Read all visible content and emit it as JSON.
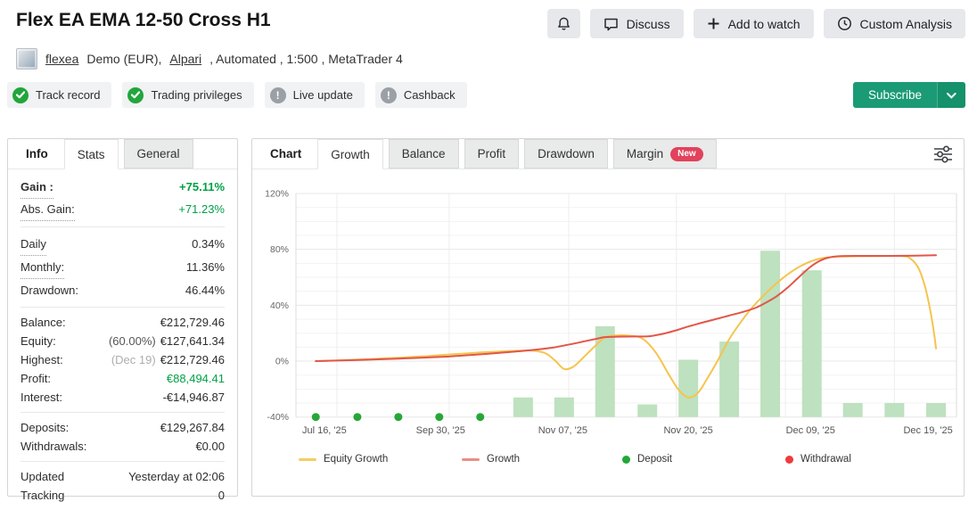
{
  "header": {
    "title": "Flex EA EMA 12-50 Cross H1",
    "actions": [
      {
        "icon": "bell",
        "label": ""
      },
      {
        "icon": "chat-bubble",
        "label": "Discuss"
      },
      {
        "icon": "plus",
        "label": "Add to watch"
      },
      {
        "icon": "clock",
        "label": "Custom Analysis"
      }
    ],
    "account": {
      "name": "flexea",
      "info_1": "Demo (EUR),",
      "broker": "Alpari",
      "info_2": ", Automated , 1:500 , MetaTrader 4"
    },
    "badges": [
      {
        "label": "Track record",
        "status": "verified",
        "icon": "check"
      },
      {
        "label": "Trading privileges",
        "status": "verified",
        "icon": "check"
      },
      {
        "label": "Live update",
        "status": "info",
        "icon": "exclamation"
      },
      {
        "label": "Cashback",
        "status": "info",
        "icon": "exclamation"
      }
    ],
    "subscribe_label": "Subscribe",
    "subscribe_color": "#1a9b75"
  },
  "sidebar": {
    "tabs": [
      {
        "label": "Info",
        "state": "title"
      },
      {
        "label": "Stats",
        "state": "selected"
      },
      {
        "label": "General",
        "state": "normal"
      }
    ],
    "groups": [
      {
        "sp": "sp1",
        "rows": [
          {
            "label": "Gain :",
            "dotted": true,
            "lbold": true,
            "value": "+75.11%",
            "vclass": "green bold"
          },
          {
            "label": "Abs. Gain:",
            "dotted": true,
            "value": "+71.23%",
            "vclass": "green"
          }
        ]
      },
      {
        "sp": "sp2",
        "rows": [
          {
            "label": "Daily",
            "dotted": true,
            "value": "0.34%"
          },
          {
            "label": "Monthly:",
            "dotted": true,
            "value": "11.36%"
          },
          {
            "label": "Drawdown:",
            "value": "46.44%"
          }
        ]
      },
      {
        "rows": [
          {
            "label": "Balance:",
            "value": "€212,729.46"
          },
          {
            "label": "Equity:",
            "prefix": "(60.00%)",
            "value": "€127,641.34"
          },
          {
            "label": "Highest:",
            "prefix": "(Dec 19)",
            "prefix_light": true,
            "value": "€212,729.46"
          },
          {
            "label": "Profit:",
            "value": "€88,494.41",
            "vclass": "green"
          },
          {
            "label": "Interest:",
            "value": "-€14,946.87"
          }
        ]
      },
      {
        "rows": [
          {
            "label": "Deposits:",
            "value": "€129,267.84"
          },
          {
            "label": "Withdrawals:",
            "value": "€0.00"
          }
        ]
      },
      {
        "rows": [
          {
            "label": "Updated",
            "value": "Yesterday at 02:06"
          },
          {
            "label": "Tracking",
            "value": "0"
          }
        ]
      }
    ]
  },
  "chart_panel": {
    "tabs": [
      {
        "label": "Chart",
        "state": "title"
      },
      {
        "label": "Growth",
        "state": "selected"
      },
      {
        "label": "Balance",
        "state": "normal"
      },
      {
        "label": "Profit",
        "state": "normal"
      },
      {
        "label": "Drawdown",
        "state": "normal"
      },
      {
        "label": "Margin",
        "state": "normal",
        "badge": "New"
      }
    ],
    "filter_icon": "sliders"
  },
  "chart_data": {
    "type": "mixed",
    "title": "Growth",
    "ylim": [
      -40,
      120
    ],
    "y_major_step": 40,
    "y_minor_step": 10,
    "y_tick_labels": [
      "-40%",
      "0%",
      "40%",
      "80%",
      "120%"
    ],
    "grid": true,
    "x_labels": [
      {
        "label": "Jul 16, '25",
        "pos": 0.043
      },
      {
        "label": "Sep 30, '25",
        "pos": 0.219
      },
      {
        "label": "Nov 07, '25",
        "pos": 0.404
      },
      {
        "label": "Nov 20, '25",
        "pos": 0.594
      },
      {
        "label": "Dec 09, '25",
        "pos": 0.779
      },
      {
        "label": "Dec 19, '25",
        "pos": 0.957
      }
    ],
    "vgrid_pos": [
      0.062,
      0.232,
      0.413,
      0.576,
      0.741,
      0.906
    ],
    "series": [
      {
        "name": "bars",
        "type": "bar",
        "color": "#bee1bf",
        "points": [
          [
            0.344,
            -26
          ],
          [
            0.406,
            -26
          ],
          [
            0.468,
            25
          ],
          [
            0.532,
            -31
          ],
          [
            0.594,
            1
          ],
          [
            0.656,
            14
          ],
          [
            0.718,
            79
          ],
          [
            0.781,
            65
          ],
          [
            0.843,
            -30
          ],
          [
            0.906,
            -30
          ],
          [
            0.969,
            -30
          ]
        ]
      },
      {
        "name": "Equity Growth",
        "type": "line",
        "color": "#f5c44e",
        "points": [
          [
            0.03,
            0
          ],
          [
            0.065,
            0.5
          ],
          [
            0.1,
            1.2
          ],
          [
            0.135,
            2.0
          ],
          [
            0.17,
            2.8
          ],
          [
            0.2,
            3.6
          ],
          [
            0.219,
            4.3
          ],
          [
            0.25,
            5.3
          ],
          [
            0.28,
            6.2
          ],
          [
            0.31,
            6.9
          ],
          [
            0.335,
            7.4
          ],
          [
            0.36,
            7.4
          ],
          [
            0.378,
            5.5
          ],
          [
            0.392,
            0.5
          ],
          [
            0.406,
            -5.6
          ],
          [
            0.42,
            -4.0
          ],
          [
            0.435,
            2.5
          ],
          [
            0.45,
            9.5
          ],
          [
            0.468,
            17.0
          ],
          [
            0.485,
            18.4
          ],
          [
            0.505,
            18.2
          ],
          [
            0.525,
            16.0
          ],
          [
            0.545,
            6.0
          ],
          [
            0.565,
            -10.0
          ],
          [
            0.58,
            -21.0
          ],
          [
            0.594,
            -26.0
          ],
          [
            0.608,
            -23.0
          ],
          [
            0.622,
            -13.0
          ],
          [
            0.638,
            0.0
          ],
          [
            0.655,
            15.0
          ],
          [
            0.672,
            27.0
          ],
          [
            0.69,
            38.0
          ],
          [
            0.708,
            47.0
          ],
          [
            0.726,
            55.0
          ],
          [
            0.744,
            62.0
          ],
          [
            0.762,
            67.5
          ],
          [
            0.78,
            71.5
          ],
          [
            0.798,
            73.8
          ],
          [
            0.82,
            74.8
          ],
          [
            0.85,
            75.1
          ],
          [
            0.88,
            75.2
          ],
          [
            0.918,
            75.2
          ],
          [
            0.93,
            73.5
          ],
          [
            0.942,
            67.0
          ],
          [
            0.952,
            54.0
          ],
          [
            0.96,
            37.0
          ],
          [
            0.966,
            20.0
          ],
          [
            0.969,
            9.0
          ]
        ]
      },
      {
        "name": "Growth",
        "type": "line",
        "color": "#e25649",
        "points": [
          [
            0.03,
            0
          ],
          [
            0.1,
            0.9
          ],
          [
            0.155,
            1.8
          ],
          [
            0.219,
            3.0
          ],
          [
            0.26,
            4.2
          ],
          [
            0.3,
            5.6
          ],
          [
            0.335,
            7.0
          ],
          [
            0.365,
            8.3
          ],
          [
            0.39,
            9.8
          ],
          [
            0.415,
            12.0
          ],
          [
            0.44,
            14.5
          ],
          [
            0.458,
            16.3
          ],
          [
            0.468,
            17.2
          ],
          [
            0.49,
            17.5
          ],
          [
            0.515,
            17.6
          ],
          [
            0.535,
            17.8
          ],
          [
            0.555,
            19.5
          ],
          [
            0.575,
            22.0
          ],
          [
            0.594,
            24.8
          ],
          [
            0.615,
            27.5
          ],
          [
            0.635,
            30.0
          ],
          [
            0.655,
            32.5
          ],
          [
            0.675,
            35.0
          ],
          [
            0.695,
            38.0
          ],
          [
            0.712,
            42.0
          ],
          [
            0.728,
            46.5
          ],
          [
            0.744,
            52.5
          ],
          [
            0.76,
            59.5
          ],
          [
            0.775,
            66.0
          ],
          [
            0.79,
            71.0
          ],
          [
            0.805,
            74.0
          ],
          [
            0.825,
            75.2
          ],
          [
            0.87,
            75.3
          ],
          [
            0.92,
            75.4
          ],
          [
            0.969,
            75.8
          ]
        ]
      },
      {
        "name": "Deposit",
        "type": "scatter",
        "color": "#27a737",
        "points": [
          [
            0.03,
            -40
          ],
          [
            0.093,
            -40
          ],
          [
            0.155,
            -40
          ],
          [
            0.217,
            -40
          ],
          [
            0.279,
            -40
          ]
        ]
      },
      {
        "name": "Withdrawal",
        "type": "scatter",
        "color": "#ee3b3b",
        "points": []
      }
    ],
    "legend": [
      {
        "label": "Equity Growth",
        "swatch": "line",
        "color": "#f6cd64"
      },
      {
        "label": "Growth",
        "swatch": "line",
        "color": "#ea8f86"
      },
      {
        "label": "Deposit",
        "swatch": "dot",
        "color": "#23a638"
      },
      {
        "label": "Withdrawal",
        "swatch": "dot",
        "color": "#ee3b3b"
      }
    ],
    "legend_position": "bottom"
  }
}
